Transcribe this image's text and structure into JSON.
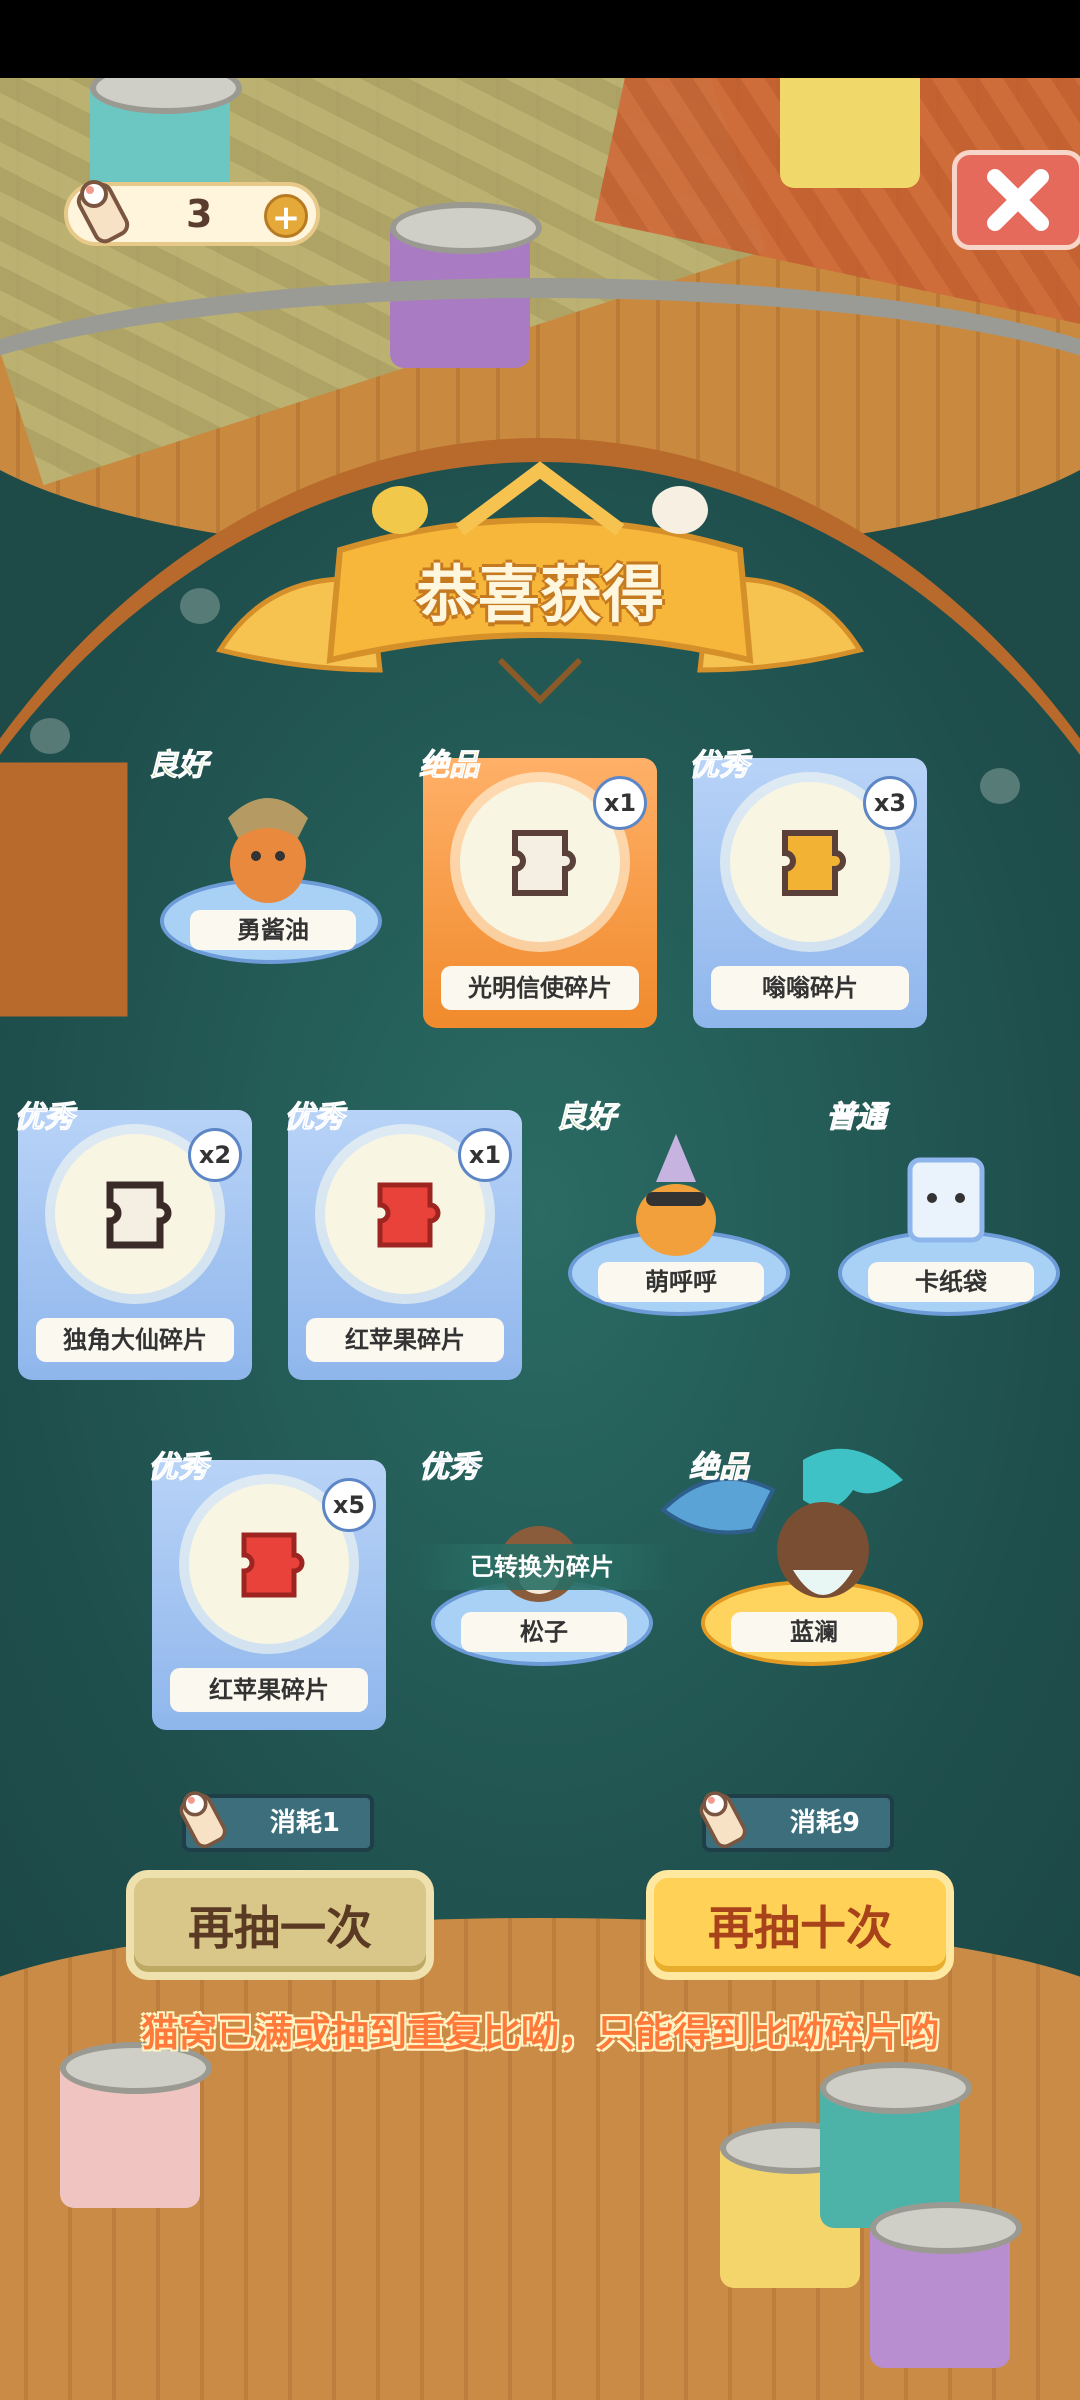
{
  "hud": {
    "ticket_count": "3",
    "plus_symbol": "+"
  },
  "banner": {
    "title": "恭喜获得"
  },
  "rewards": [
    {
      "rarity": "良好",
      "name": "勇酱油",
      "type": "character"
    },
    {
      "rarity": "绝品",
      "name": "光明信使碎片",
      "type": "fragment",
      "count": "x1"
    },
    {
      "rarity": "优秀",
      "name": "嗡嗡碎片",
      "type": "fragment",
      "count": "x3"
    },
    {
      "rarity": "优秀",
      "name": "独角大仙碎片",
      "type": "fragment",
      "count": "x2"
    },
    {
      "rarity": "优秀",
      "name": "红苹果碎片",
      "type": "fragment",
      "count": "x1"
    },
    {
      "rarity": "良好",
      "name": "萌呼呼",
      "type": "character"
    },
    {
      "rarity": "普通",
      "name": "卡纸袋",
      "type": "character"
    },
    {
      "rarity": "优秀",
      "name": "红苹果碎片",
      "type": "fragment",
      "count": "x5"
    },
    {
      "rarity": "优秀",
      "name": "松子",
      "type": "character",
      "note": "已转换为碎片"
    },
    {
      "rarity": "绝品",
      "name": "蓝澜",
      "type": "character"
    }
  ],
  "actions": {
    "once_cost": "消耗1",
    "once_label": "再抽一次",
    "ten_cost": "消耗9",
    "ten_label": "再抽十次"
  },
  "notice": "猫窝已满或抽到重复比呦，只能得到比呦碎片哟",
  "colors": {
    "rarity_good": "#6fb33b",
    "rarity_great": "#3f7ad6",
    "rarity_best": "#f08a18",
    "rarity_normal": "#9aa4ae"
  },
  "icons": [
    "ticket-icon",
    "plus-icon",
    "close-icon"
  ]
}
